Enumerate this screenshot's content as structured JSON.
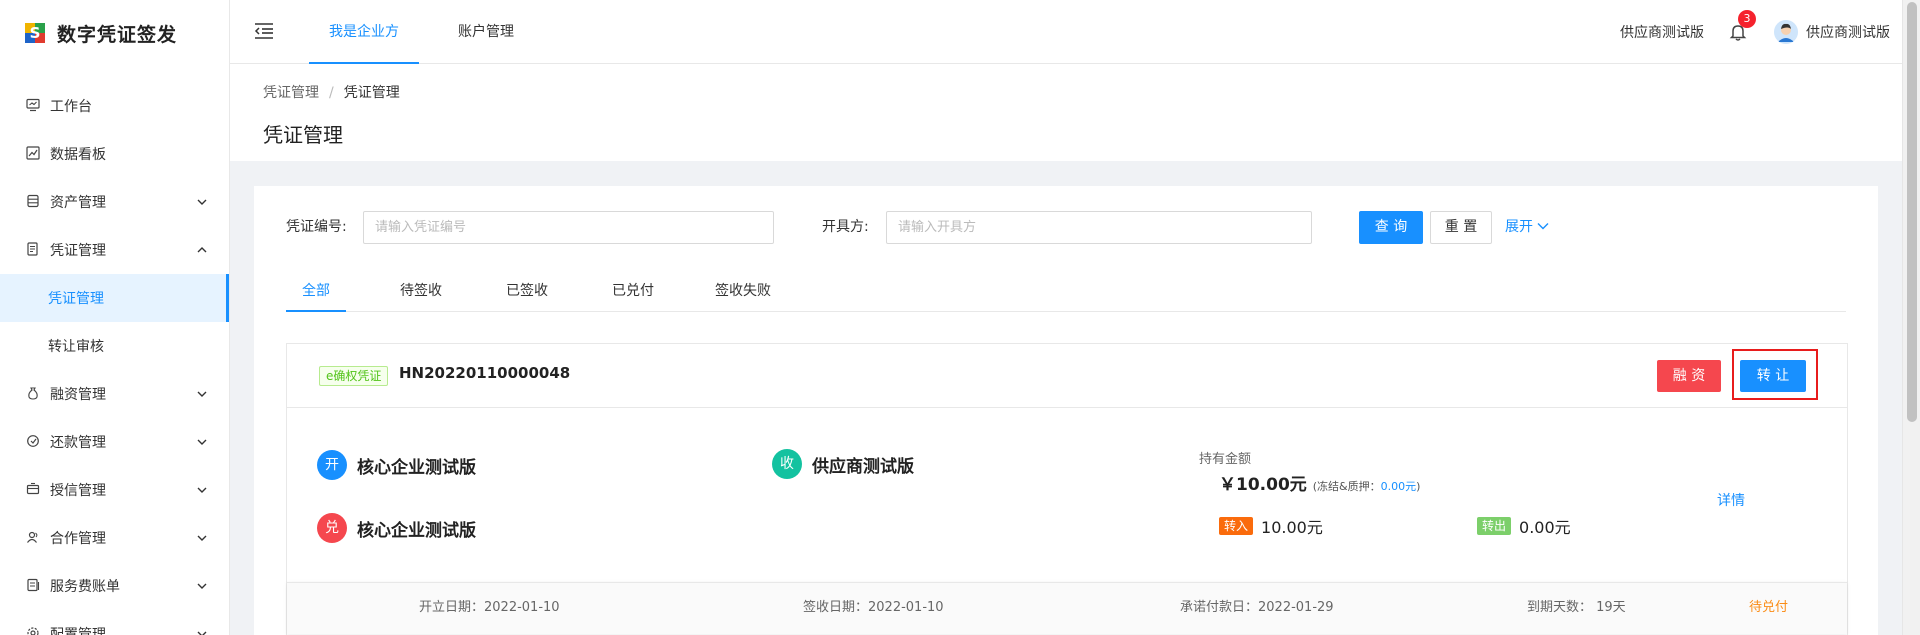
{
  "app": {
    "title": "数字凭证签发"
  },
  "sidebar": {
    "items": [
      {
        "label": "工作台",
        "icon": "monitor-icon"
      },
      {
        "label": "数据看板",
        "icon": "chart-icon"
      },
      {
        "label": "资产管理",
        "icon": "database-icon"
      },
      {
        "label": "凭证管理",
        "icon": "document-icon"
      },
      {
        "label": "融资管理",
        "icon": "money-bag-icon"
      },
      {
        "label": "还款管理",
        "icon": "repay-icon"
      },
      {
        "label": "授信管理",
        "icon": "credit-icon"
      },
      {
        "label": "合作管理",
        "icon": "partner-icon"
      },
      {
        "label": "服务费账单",
        "icon": "bill-icon"
      },
      {
        "label": "配置管理",
        "icon": "gear-icon"
      }
    ],
    "sub": {
      "voucher_manage": "凭证管理",
      "transfer_review": "转让审核"
    }
  },
  "topbar": {
    "tabs": [
      "我是企业方",
      "账户管理"
    ],
    "org": "供应商测试版",
    "badge": "3",
    "user": "供应商测试版"
  },
  "breadcrumb": {
    "parent": "凭证管理",
    "sep": "/",
    "current": "凭证管理"
  },
  "page": {
    "title": "凭证管理"
  },
  "filter": {
    "voucher_no_label": "凭证编号:",
    "voucher_no_placeholder": "请输入凭证编号",
    "issuer_label": "开具方:",
    "issuer_placeholder": "请输入开具方",
    "query": "查 询",
    "reset": "重 置",
    "expand": "展开"
  },
  "tabs": [
    "全部",
    "待签收",
    "已签收",
    "已兑付",
    "签收失败"
  ],
  "voucher": {
    "tag": "e确权凭证",
    "number": "HN20220110000048",
    "finance_btn": "融 资",
    "transfer_btn": "转 让",
    "issuer_mark": "开",
    "issuer": "核心企业测试版",
    "receiver_mark": "收",
    "receiver": "供应商测试版",
    "payer_mark": "兑",
    "payer": "核心企业测试版",
    "amount_label": "持有金额",
    "amount": "￥10.00元",
    "frozen_label": "(冻结&质押：",
    "frozen_value": "0.00元",
    "frozen_close": ")",
    "in_tag": "转入",
    "in_value": "10.00元",
    "out_tag": "转出",
    "out_value": "0.00元",
    "detail": "详情",
    "open_date": "开立日期：2022-01-10",
    "sign_date": "签收日期：2022-01-10",
    "promise_date": "承诺付款日：2022-01-29",
    "days": "到期天数：  19天",
    "status": "待兑付"
  },
  "colors": {
    "primary": "#1890ff",
    "danger": "#f5474e",
    "issuer_circle": "#1890ff",
    "receiver_circle": "#13c2a0",
    "payer_circle": "#f5474e",
    "in_tag": "#fa6b0c",
    "out_tag": "#7ccf6a",
    "status": "#fa8c16"
  }
}
